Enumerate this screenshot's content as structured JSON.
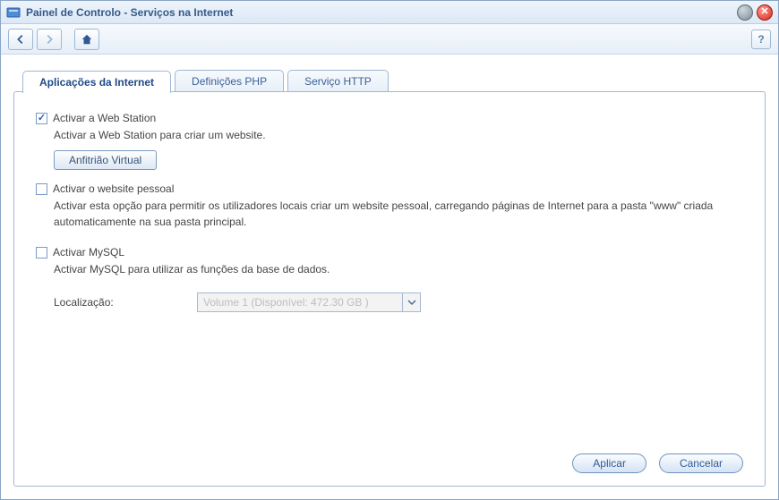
{
  "window": {
    "title": "Painel de Controlo - Serviços na Internet"
  },
  "toolbar": {
    "help_label": "?"
  },
  "tabs": [
    {
      "label": "Aplicações da Internet",
      "active": true
    },
    {
      "label": "Definições PHP",
      "active": false
    },
    {
      "label": "Serviço HTTP",
      "active": false
    }
  ],
  "webstation": {
    "checkbox_label": "Activar a Web Station",
    "checked": true,
    "description": "Activar a Web Station para criar um website.",
    "virtual_host_btn": "Anfitrião Virtual"
  },
  "personal": {
    "checkbox_label": "Activar o website pessoal",
    "checked": false,
    "description": "Activar esta opção para permitir os utilizadores locais criar um website pessoal, carregando páginas de Internet para a pasta \"www\" criada automaticamente na sua pasta principal."
  },
  "mysql": {
    "checkbox_label": "Activar MySQL",
    "checked": false,
    "description": "Activar MySQL para utilizar as funções da base de dados.",
    "location_label": "Localização:",
    "location_value": "Volume 1 (Disponível: 472.30 GB )",
    "location_disabled": true
  },
  "footer": {
    "apply": "Aplicar",
    "cancel": "Cancelar"
  }
}
